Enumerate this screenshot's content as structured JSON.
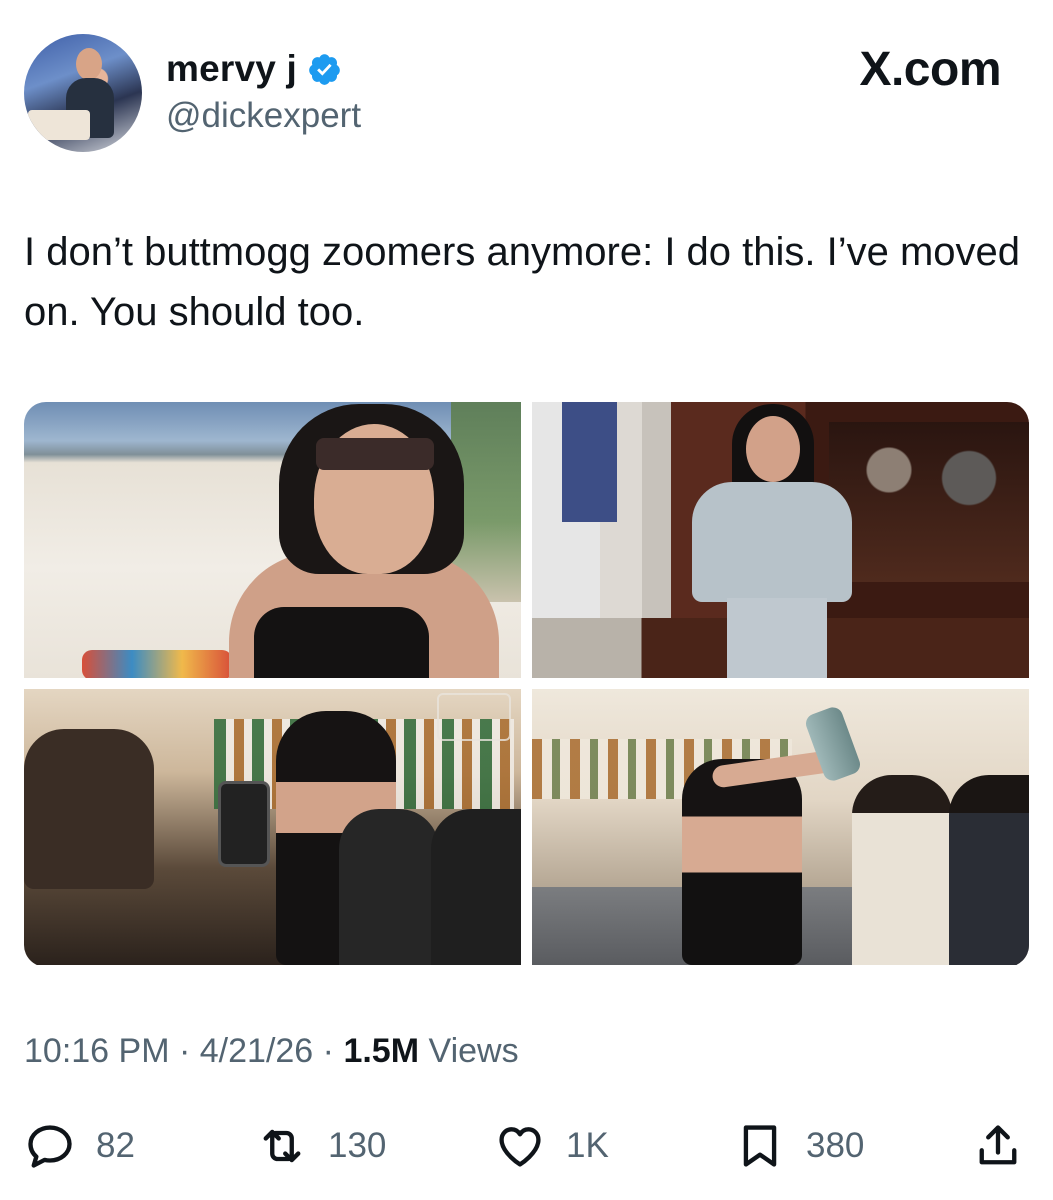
{
  "author": {
    "display_name": "mervy j",
    "handle": "@dickexpert",
    "verified_icon": "verified-badge-icon",
    "avatar_icon": "avatar"
  },
  "brand": {
    "label": "X.com"
  },
  "tweet": {
    "text": "I don’t buttmogg zoomers anymore: I do this. I’ve moved on. You should too."
  },
  "meta": {
    "time": "10:16 PM",
    "separator": "·",
    "date": "4/21/26",
    "views_count": "1.5M",
    "views_label": "Views"
  },
  "actions": {
    "reply": {
      "count": "82",
      "icon": "reply-icon"
    },
    "repost": {
      "count": "130",
      "icon": "repost-icon"
    },
    "like": {
      "count": "1K",
      "icon": "heart-icon"
    },
    "bookmark": {
      "count": "380",
      "icon": "bookmark-icon"
    },
    "share": {
      "icon": "share-icon"
    }
  },
  "colors": {
    "text": "#0f1419",
    "secondary": "#536471",
    "verified": "#1d9bf0",
    "background": "#ffffff"
  }
}
